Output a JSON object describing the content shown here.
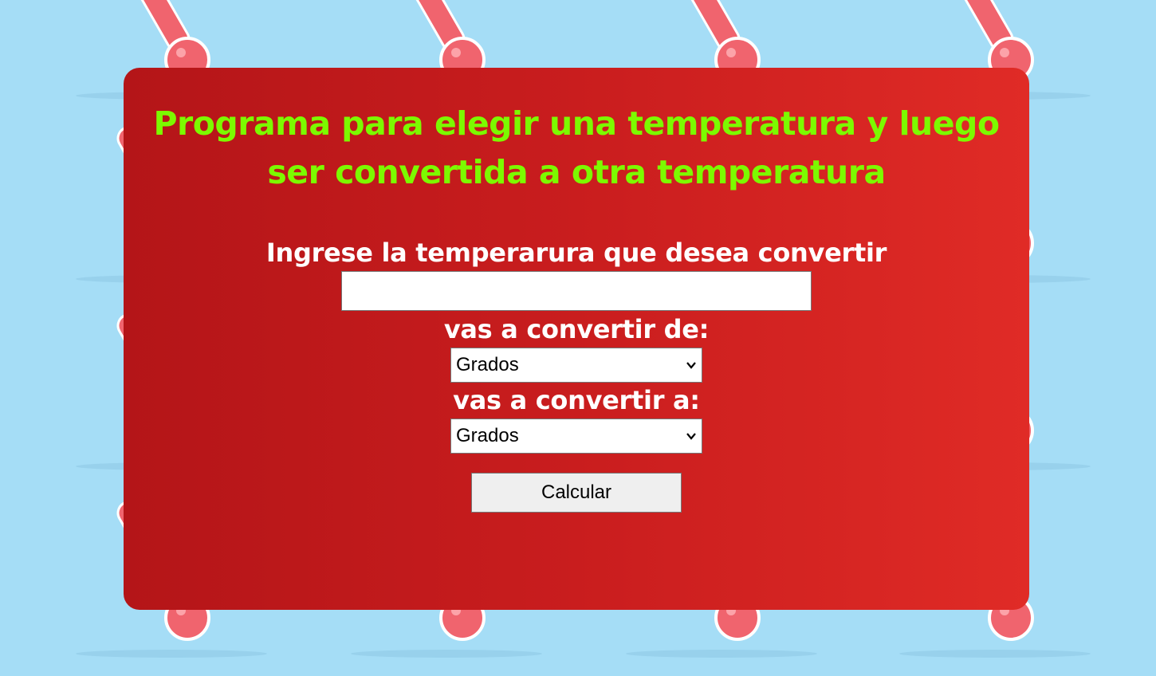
{
  "title": "Programa para elegir una temperatura y luego ser convertida a otra temperatura",
  "form": {
    "temperature_label": "Ingrese la temperarura que desea convertir",
    "temperature_value": "",
    "from_label": "vas a convertir de:",
    "from_selected": "Grados",
    "to_label": "vas a convertir a:",
    "to_selected": "Grados",
    "submit_label": "Calcular"
  },
  "colors": {
    "background": "#a5ddf6",
    "card_start": "#b41518",
    "card_end": "#e02b26",
    "title": "#7cfa00",
    "label": "#ffffff",
    "thermometer": "#f0646e"
  },
  "icons": {
    "background": "thermometer-icon",
    "select_arrow": "chevron-down-icon"
  }
}
